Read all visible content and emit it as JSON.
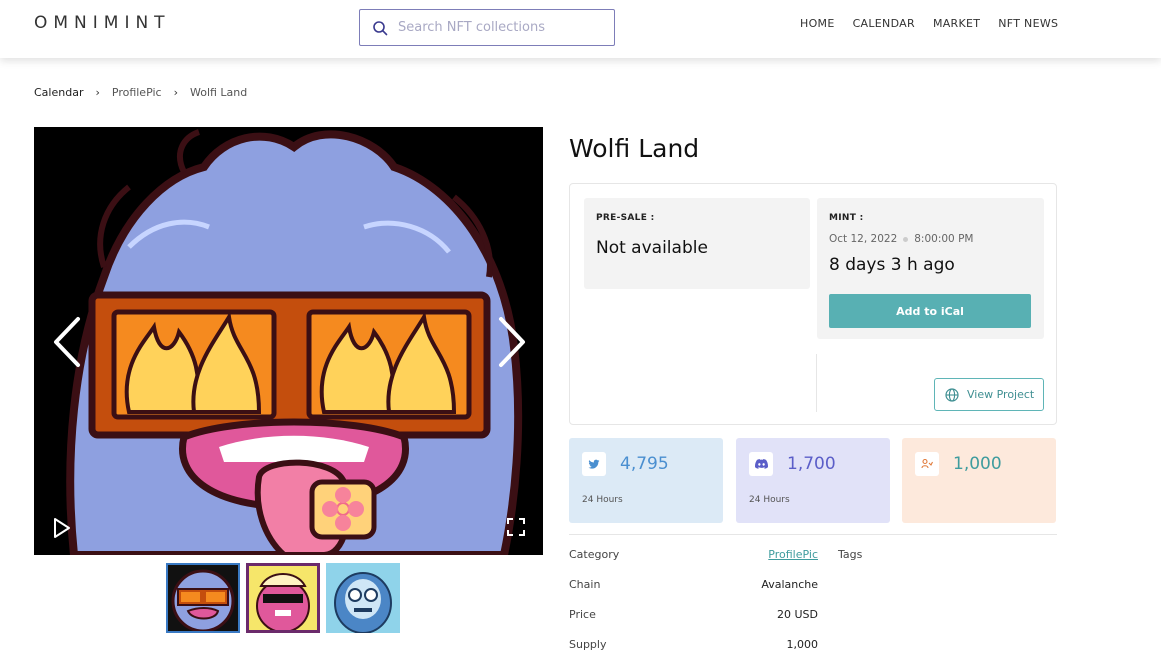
{
  "header": {
    "logo": "OMNIMINT",
    "search_placeholder": "Search NFT collections",
    "nav": [
      "HOME",
      "CALENDAR",
      "MARKET",
      "NFT NEWS"
    ]
  },
  "breadcrumb": [
    "Calendar",
    "ProfilePic",
    "Wolfi Land"
  ],
  "project": {
    "title": "Wolfi Land",
    "presale_label": "PRE-SALE :",
    "presale_value": "Not available",
    "mint_label": "MINT :",
    "mint_date": "Oct 12, 2022",
    "mint_time": "8:00:00 PM",
    "mint_ago": "8 days 3 h ago",
    "ical_label": "Add to iCal",
    "view_project_label": "View Project"
  },
  "stats": [
    {
      "icon": "twitter-icon",
      "value": "4,795",
      "period": "24 Hours"
    },
    {
      "icon": "discord-icon",
      "value": "1,700",
      "period": "24 Hours"
    },
    {
      "icon": "supply-icon",
      "value": "1,000",
      "period": ""
    }
  ],
  "details": {
    "category_label": "Category",
    "category_value": "ProfilePic",
    "chain_label": "Chain",
    "chain_value": "Avalanche",
    "price_label": "Price",
    "price_value": "20 USD",
    "supply_label": "Supply",
    "supply_value": "1,000",
    "tags_label": "Tags"
  },
  "colors": {
    "accent": "#58b0b3",
    "twitter_bg": "#dceaf6",
    "discord_bg": "#e1e2f8",
    "supply_bg": "#fde9dc",
    "search_border": "#7d7db8"
  }
}
